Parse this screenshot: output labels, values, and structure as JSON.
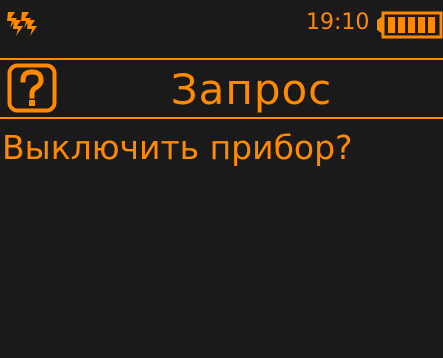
{
  "status_bar": {
    "app_icon": "double-arrow-icon",
    "time": "19:10",
    "battery_icon": "battery-full-icon"
  },
  "dialog": {
    "icon": "question-icon",
    "title": "Запрос",
    "message": "Выключить прибор?"
  },
  "colors": {
    "accent": "#ff8a00",
    "background": "#1a1a1a"
  }
}
